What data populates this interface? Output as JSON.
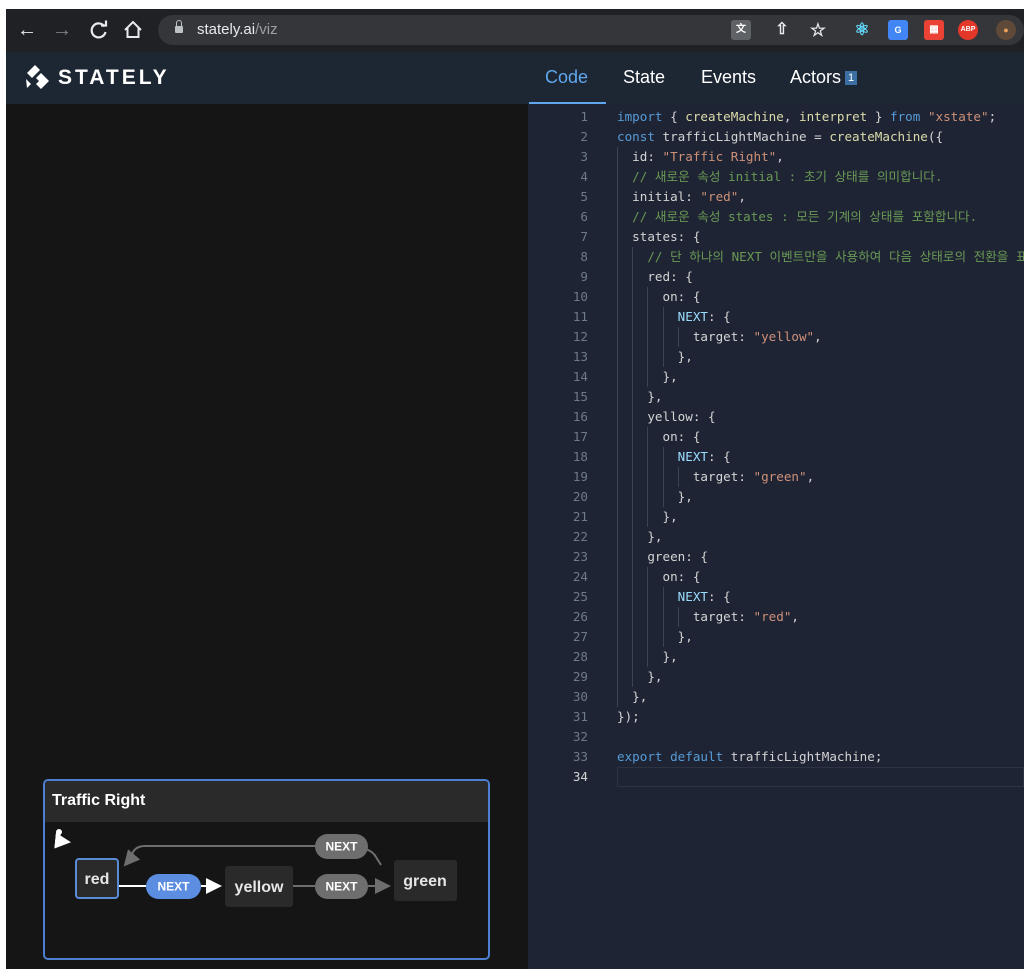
{
  "browser": {
    "url_host": "stately.ai",
    "url_path": "/viz",
    "toolbar_icons": [
      "translate-icon",
      "share-icon",
      "star-icon",
      "react-devtools-icon",
      "google-translate-icon",
      "extension-icon",
      "adblock-plus-icon",
      "profile-icon"
    ],
    "abp_label": "ABP"
  },
  "app": {
    "brand": "STATELY",
    "tabs": [
      {
        "label": "Code",
        "active": true
      },
      {
        "label": "State",
        "active": false
      },
      {
        "label": "Events",
        "active": false
      },
      {
        "label": "Actors",
        "active": false,
        "badge": "1"
      }
    ]
  },
  "editor": {
    "active_line": 34,
    "lines": [
      "import { createMachine, interpret } from \"xstate\";",
      "const trafficLightMachine = createMachine({",
      "  id: \"Traffic Right\",",
      "  // 새로운 속성 initial : 초기 상태를 의미합니다.",
      "  initial: \"red\",",
      "  // 새로운 속성 states : 모든 기계의 상태를 포함합니다.",
      "  states: {",
      "    // 단 하나의 NEXT 이벤트만을 사용하여 다음 상태로의 전환을 표",
      "    red: {",
      "      on: {",
      "        NEXT: {",
      "          target: \"yellow\",",
      "        },",
      "      },",
      "    },",
      "    yellow: {",
      "      on: {",
      "        NEXT: {",
      "          target: \"green\",",
      "        },",
      "      },",
      "    },",
      "    green: {",
      "      on: {",
      "        NEXT: {",
      "          target: \"red\",",
      "        },",
      "      },",
      "    },",
      "  },",
      "});",
      "",
      "export default trafficLightMachine;",
      ""
    ]
  },
  "machine": {
    "title": "Traffic Right",
    "states": [
      "red",
      "yellow",
      "green"
    ],
    "events": [
      "NEXT",
      "NEXT",
      "NEXT"
    ],
    "colors": {
      "active_state_border": "#5a8bd6",
      "active_event": "#5b8de0",
      "inactive_event": "#6e6e6e"
    }
  }
}
